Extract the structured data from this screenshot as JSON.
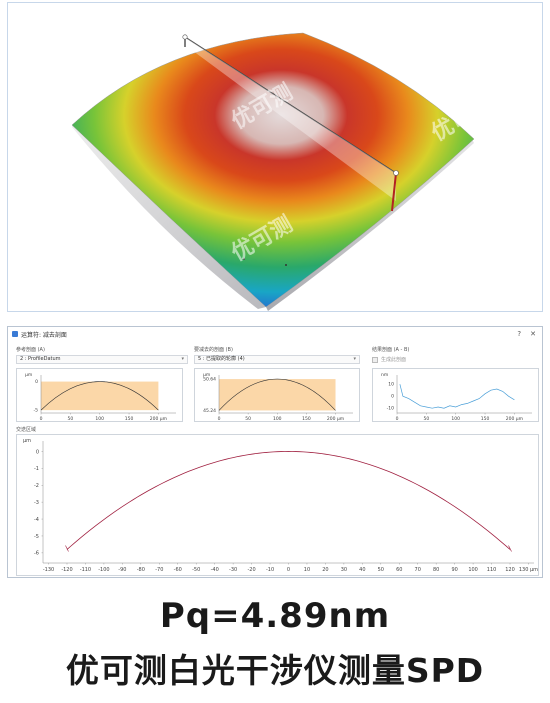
{
  "watermark": {
    "text": "优可测"
  },
  "window": {
    "title": "运算符: 减去剖面",
    "help_glyph": "?",
    "close_glyph": "✕",
    "reference_section": {
      "label": "参考剖面 (A)",
      "selected": "2 : ProfileDatum"
    },
    "subtract_section": {
      "label": "要减去的剖面 (B)",
      "selected": "5 : 已提取的轮廓 (4)"
    },
    "result_section": {
      "label": "结果剖面 (A - B)",
      "checkbox_label": "生成此剖面",
      "checkbox_checked": false
    },
    "intersection_section": {
      "label": "交迭区域"
    },
    "chart_a": {
      "y_unit": "μm",
      "y_ticks": [
        "0",
        "-5"
      ],
      "x_ticks": [
        "0",
        "50",
        "100",
        "150",
        "200 μm"
      ],
      "fill_color": "#fbd7a8",
      "line_color": "#333333"
    },
    "chart_b": {
      "y_unit": "μm",
      "y_ticks": [
        "50.64",
        "45.24"
      ],
      "x_ticks": [
        "0",
        "50",
        "100",
        "150",
        "200 μm"
      ],
      "fill_color": "#fbd7a8",
      "line_color": "#333333"
    },
    "chart_c": {
      "y_unit": "nm",
      "y_ticks": [
        "10",
        "0",
        "-10"
      ],
      "x_ticks": [
        "0",
        "50",
        "100",
        "150",
        "200 μm"
      ],
      "line_color": "#4a9fd8"
    },
    "main_chart": {
      "y_unit": "μm",
      "y_ticks": [
        "0",
        "-1",
        "-2",
        "-3",
        "-4",
        "-5",
        "-6"
      ],
      "x_ticks": [
        "-130",
        "-120",
        "-110",
        "-100",
        "-90",
        "-80",
        "-70",
        "-60",
        "-50",
        "-40",
        "-30",
        "-20",
        "-10",
        "0",
        "10",
        "20",
        "30",
        "40",
        "50",
        "60",
        "70",
        "80",
        "90",
        "100",
        "110",
        "120",
        "130 μm"
      ],
      "line_color": "#a02040"
    }
  },
  "chart_data": [
    {
      "type": "line",
      "x": [
        0,
        50,
        100,
        150,
        200
      ],
      "y": [
        -5,
        -1,
        0,
        -1,
        -5
      ],
      "x_range": [
        0,
        230
      ],
      "y_range": [
        -5.5,
        0.8
      ]
    },
    {
      "type": "line",
      "x": [
        0,
        50,
        100,
        150,
        200
      ],
      "y": [
        45.24,
        49.3,
        50.64,
        49.3,
        45.24
      ],
      "x_range": [
        0,
        230
      ],
      "y_range": [
        44.8,
        51.0
      ]
    },
    {
      "type": "line",
      "x": [
        5,
        10,
        20,
        30,
        40,
        50,
        60,
        70,
        80,
        90,
        100,
        110,
        120,
        130,
        140,
        150,
        160,
        170,
        180,
        190,
        200
      ],
      "y": [
        10,
        0,
        -2,
        -5,
        -8,
        -9,
        -10,
        -9,
        -10,
        -8,
        -9,
        -7,
        -6,
        -4,
        -2,
        2,
        5,
        6,
        4,
        0,
        -3
      ],
      "x_range": [
        0,
        230
      ],
      "y_range": [
        -14,
        16
      ]
    },
    {
      "type": "line",
      "x": [
        -120,
        -100,
        -80,
        -60,
        -40,
        -20,
        0,
        20,
        40,
        60,
        80,
        100,
        120
      ],
      "y": [
        -5.8,
        -4.0,
        -2.57,
        -1.44,
        -0.64,
        -0.16,
        0,
        -0.16,
        -0.64,
        -1.44,
        -2.57,
        -4.0,
        -5.8
      ],
      "x_range": [
        -133,
        133
      ],
      "y_range": [
        -6.6,
        0.5
      ]
    }
  ],
  "captions": {
    "line1": "Pq=4.89nm",
    "line2": "优可测白光干涉仪测量SPD"
  }
}
